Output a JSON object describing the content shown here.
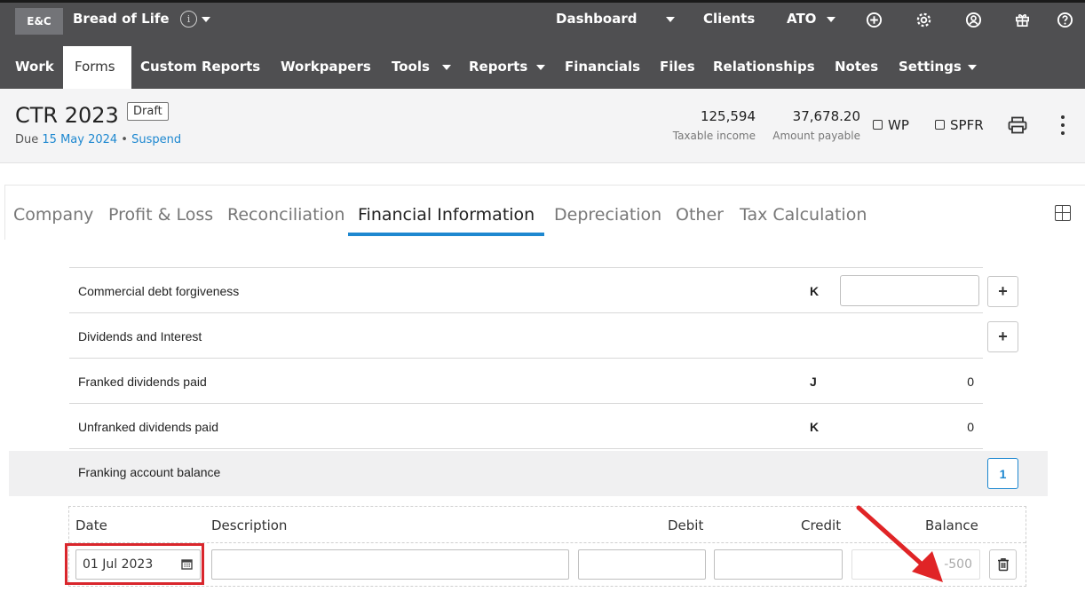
{
  "topbar": {
    "badge": "E&C",
    "client": "Bread of Life",
    "info_icon": "i",
    "dashboard": "Dashboard",
    "clients": "Clients",
    "ato": "ATO",
    "icons": [
      "plus-circle-icon",
      "gear-icon",
      "account-icon",
      "gift-icon",
      "help-icon"
    ]
  },
  "nav": {
    "items": [
      "Work",
      "Forms",
      "Custom Reports",
      "Workpapers",
      "Tools",
      "Reports",
      "Financials",
      "Files",
      "Relationships",
      "Notes",
      "Settings"
    ],
    "active": "Forms"
  },
  "header": {
    "title": "CTR 2023",
    "status": "Draft",
    "due_prefix": "Due ",
    "due_date": "15 May 2024",
    "separator": " • ",
    "suspend": "Suspend",
    "taxable_income_value": "125,594",
    "taxable_income_label": "Taxable income",
    "amount_payable_value": "37,678.20",
    "amount_payable_label": "Amount payable",
    "wp": "WP",
    "spfr": "SPFR"
  },
  "tabs": {
    "items": [
      "Company",
      "Profit & Loss",
      "Reconciliation",
      "Financial Information",
      "Depreciation",
      "Other",
      "Tax Calculation"
    ],
    "active": "Financial Information"
  },
  "rows": [
    {
      "label": "Commercial debt forgiveness",
      "code": "K",
      "value": "",
      "has_input": true,
      "has_add": true
    },
    {
      "label": "Dividends and Interest",
      "code": "",
      "value": "",
      "has_input": false,
      "has_add": true
    },
    {
      "label": "Franked dividends paid",
      "code": "J",
      "value": "0",
      "has_input": false,
      "has_add": false
    },
    {
      "label": "Unfranked dividends paid",
      "code": "K",
      "value": "0",
      "has_input": false,
      "has_add": false
    },
    {
      "label": "Franking account balance",
      "code": "",
      "value": "",
      "has_input": false,
      "has_add": false,
      "count": "1"
    }
  ],
  "franking_table": {
    "headers": {
      "date": "Date",
      "description": "Description",
      "debit": "Debit",
      "credit": "Credit",
      "balance": "Balance"
    },
    "row": {
      "date": "01 Jul 2023",
      "description": "",
      "debit": "",
      "credit": "",
      "balance": "-500"
    }
  },
  "colors": {
    "topbar": "#4f4f51",
    "accent": "#1e88d0",
    "highlight": "#d9262c"
  }
}
